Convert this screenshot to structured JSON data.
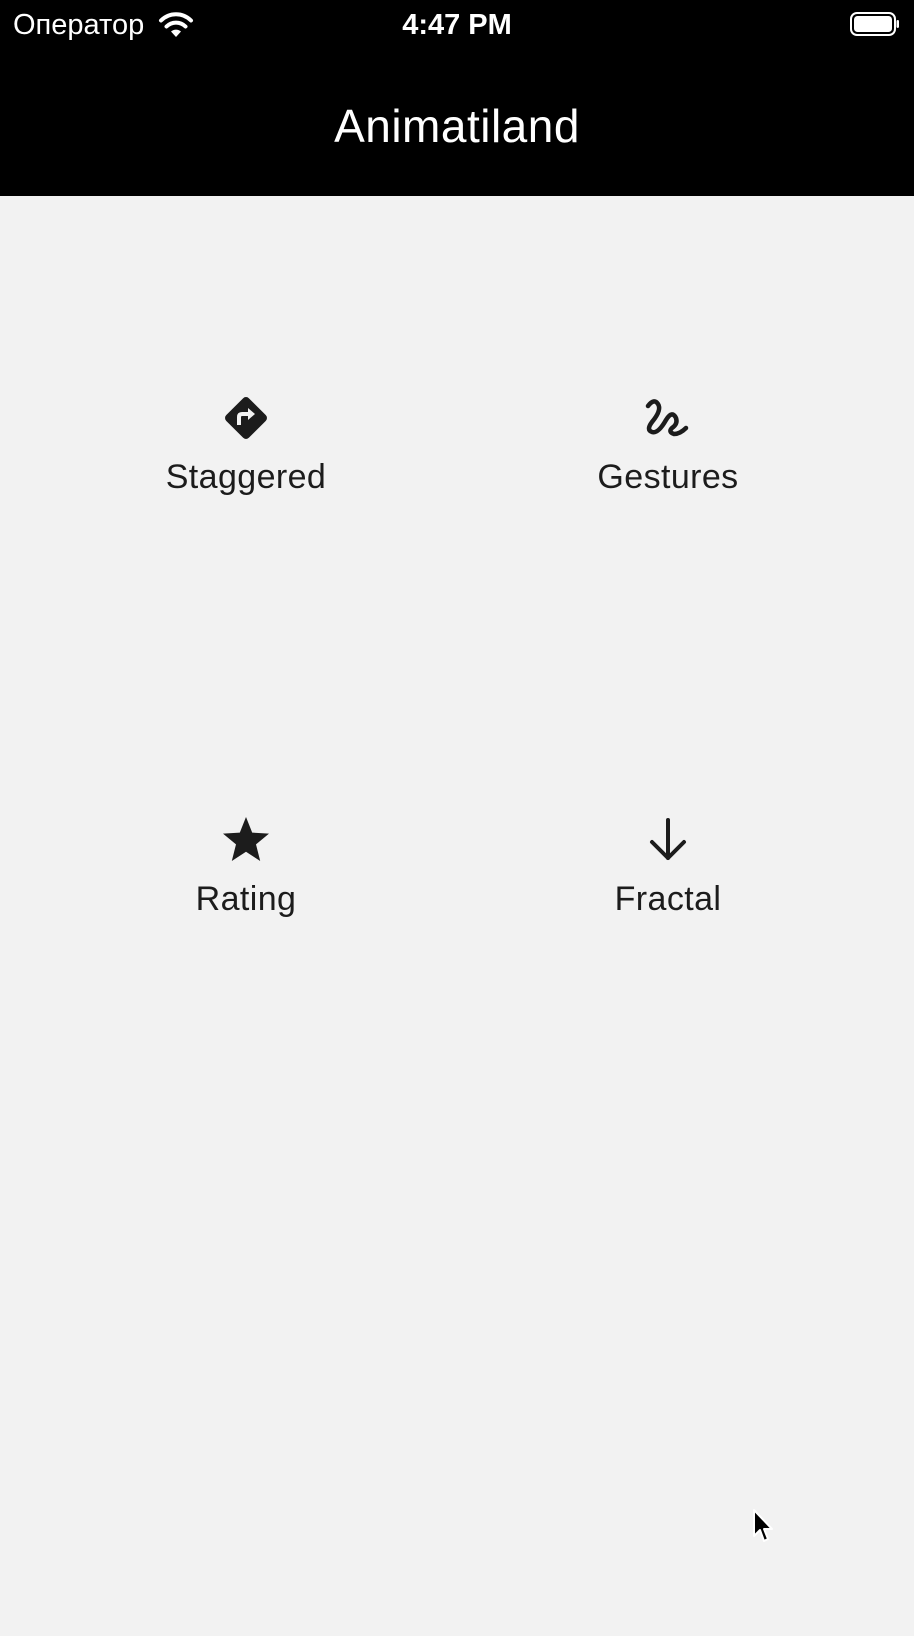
{
  "status_bar": {
    "carrier": "Оператор",
    "time": "4:47 PM",
    "wifi_icon": "wifi-icon",
    "battery_icon": "battery-full-icon"
  },
  "header": {
    "title": "Animatiland"
  },
  "tiles": [
    {
      "label": "Staggered",
      "icon": "directions-diamond-icon"
    },
    {
      "label": "Gestures",
      "icon": "gesture-squiggle-icon"
    },
    {
      "label": "Rating",
      "icon": "star-icon"
    },
    {
      "label": "Fractal",
      "icon": "arrow-down-icon"
    }
  ],
  "colors": {
    "header_bg": "#000000",
    "page_bg": "#f2f2f2",
    "text": "#1c1c1c"
  }
}
